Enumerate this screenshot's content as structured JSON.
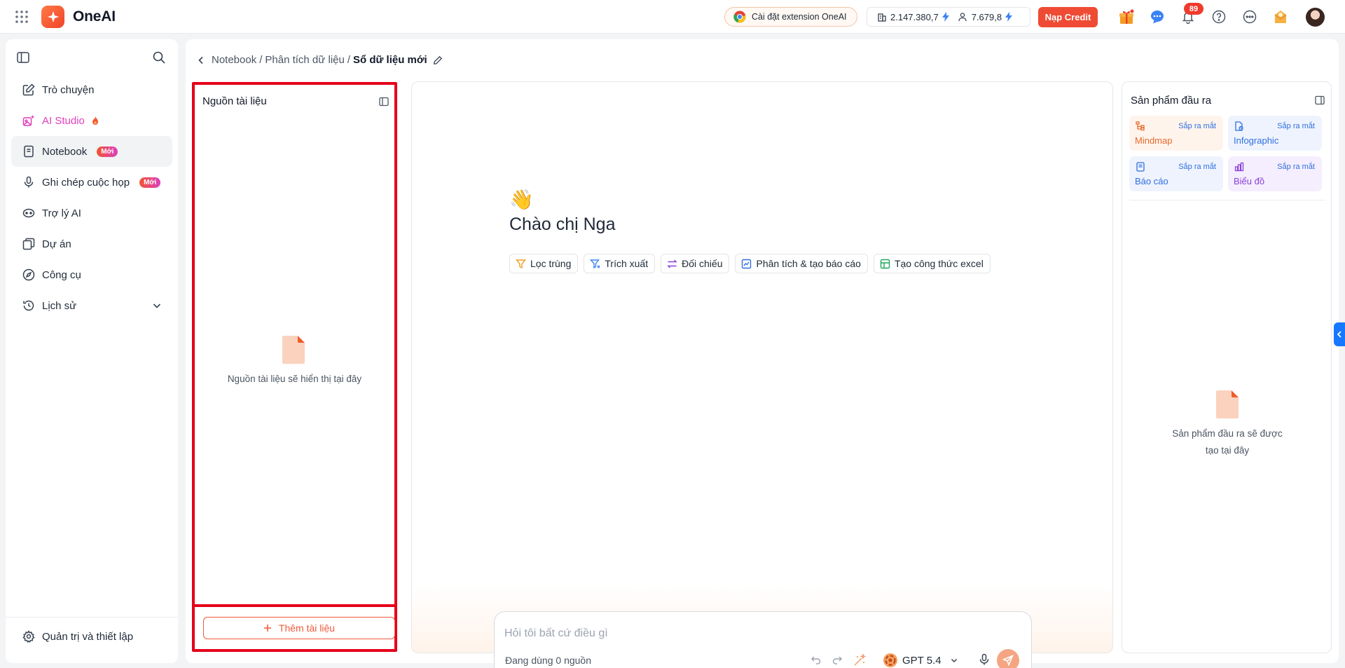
{
  "app": {
    "brand": "OneAI"
  },
  "topbar": {
    "extension_label": "Cài đặt extension OneAI",
    "credit_org": "2.147.380,7",
    "credit_user": "7.679,8",
    "topup_label": "Nạp Credit",
    "notification_count": "89"
  },
  "sidebar": {
    "items": [
      {
        "label": "Trò chuyện",
        "icon": "edit-icon"
      },
      {
        "label": "AI Studio",
        "icon": "ai-studio-icon"
      },
      {
        "label": "Notebook",
        "badge": "Mới",
        "icon": "notebook-icon"
      },
      {
        "label": "Ghi chép cuộc họp",
        "badge": "Mới",
        "icon": "microphone-icon"
      },
      {
        "label": "Trợ lý AI",
        "icon": "robot-icon"
      },
      {
        "label": "Dự án",
        "icon": "folder-icon"
      },
      {
        "label": "Công cụ",
        "icon": "compass-icon"
      },
      {
        "label": "Lịch sử",
        "icon": "history-icon"
      }
    ],
    "settings_label": "Quản trị và thiết lập"
  },
  "breadcrumb": {
    "parts": [
      "Notebook",
      "/",
      "Phân tích dữ liệu",
      "/",
      "Sổ dữ liệu mới"
    ]
  },
  "sources": {
    "title": "Nguồn tài liệu",
    "empty_text": "Nguồn tài liệu sẽ hiển thị tại đây",
    "add_label": "Thêm tài liệu"
  },
  "chat": {
    "wave": "👋",
    "greeting": "Chào chị Nga",
    "chips": [
      {
        "label": "Lọc trùng",
        "icon": "filter-icon"
      },
      {
        "label": "Trích xuất",
        "icon": "extract-icon"
      },
      {
        "label": "Đối chiếu",
        "icon": "compare-icon"
      },
      {
        "label": "Phân tích & tạo báo cáo",
        "icon": "chart-line-icon"
      },
      {
        "label": "Tạo công thức excel",
        "icon": "table-icon"
      }
    ],
    "input_placeholder": "Hỏi tôi bất cứ điều gì",
    "source_count": "Đang dùng 0 nguồn",
    "model": "GPT 5.4"
  },
  "outputs": {
    "title": "Sản phẩm đầu ra",
    "cards": [
      {
        "label": "Mindmap",
        "soon": "Sắp ra mắt",
        "color": "#e86a2c",
        "bg": "#fff4ec"
      },
      {
        "label": "Infographic",
        "soon": "Sắp ra mắt",
        "color": "#2f6fde",
        "bg": "#eef3fe"
      },
      {
        "label": "Báo cáo",
        "soon": "Sắp ra mắt",
        "color": "#2f6fde",
        "bg": "#eef3fe"
      },
      {
        "label": "Biểu đồ",
        "soon": "Sắp ra mắt",
        "color": "#8a3fd9",
        "bg": "#f5eefe"
      }
    ],
    "empty_line1": "Sản phẩm đầu ra sẽ được",
    "empty_line2": "tạo tại đây"
  }
}
